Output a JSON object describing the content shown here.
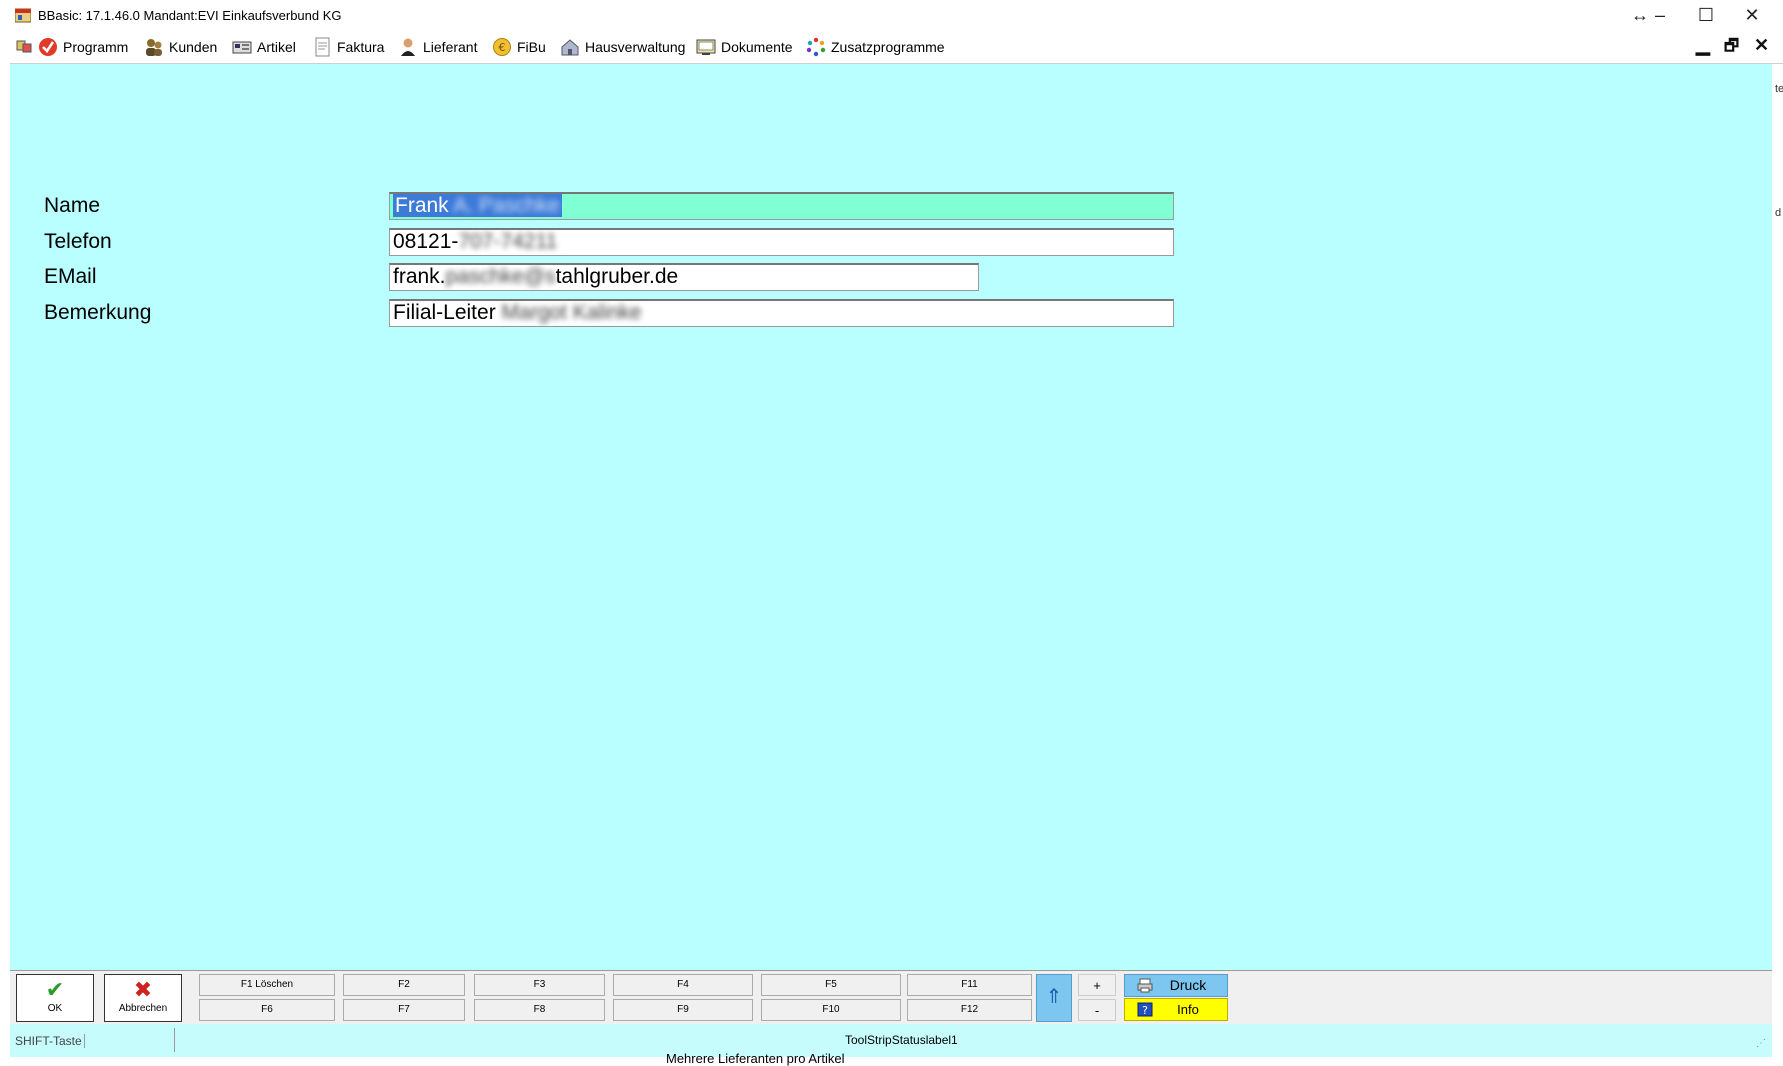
{
  "window": {
    "title": "BBasic: 17.1.46.0 Mandant:EVI Einkaufsverbund KG",
    "controls": {
      "resize_glyph": "↔",
      "minimize": "–",
      "maximize": "☐",
      "close": "✕"
    }
  },
  "menubar": {
    "items": [
      {
        "label": "Programm",
        "icon": "programm-icon"
      },
      {
        "label": "Kunden",
        "icon": "kunden-icon"
      },
      {
        "label": "Artikel",
        "icon": "artikel-icon"
      },
      {
        "label": "Faktura",
        "icon": "faktura-icon"
      },
      {
        "label": "Lieferant",
        "icon": "lieferant-icon"
      },
      {
        "label": "FiBu",
        "icon": "fibu-icon"
      },
      {
        "label": "Hausverwaltung",
        "icon": "hausverwaltung-icon"
      },
      {
        "label": "Dokumente",
        "icon": "dokumente-icon"
      },
      {
        "label": "Zusatzprogramme",
        "icon": "zusatzprogramme-icon"
      }
    ],
    "mdi_controls": {
      "minimize": "▁",
      "restore": "🗗",
      "close": "✕"
    }
  },
  "form": {
    "name": {
      "label": "Name",
      "value_clear": "Frank",
      "value_blurred": "A. Paschke"
    },
    "telefon": {
      "label": "Telefon",
      "value_clear": "08121-",
      "value_blurred": "707-74211"
    },
    "email": {
      "label": "EMail",
      "value_clear_prefix": "frank.",
      "value_blurred": "paschke@s",
      "value_clear_suffix": "tahlgruber.de"
    },
    "bemerkung": {
      "label": "Bemerkung",
      "value_clear": "Filial-Leiter",
      "value_blurred": "Margot Kalinke"
    }
  },
  "bottombar": {
    "ok_label": "OK",
    "cancel_label": "Abbrechen",
    "fkeys_top": [
      "F1 Löschen",
      "F2",
      "F3",
      "F4",
      "F5",
      "F11"
    ],
    "fkeys_bottom": [
      "F6",
      "F7",
      "F8",
      "F9",
      "F10",
      "F12"
    ],
    "plus": "+",
    "minus": "-",
    "druck_label": "Druck",
    "info_label": "Info"
  },
  "statusbar": {
    "shift_label": "SHIFT-Taste",
    "status_label": "ToolStripStatuslabel1"
  },
  "background_text": {
    "behind_window": "Mehrere Lieferanten pro Artikel",
    "edge_right_1": "te",
    "edge_right_2": "d"
  },
  "colors": {
    "client_bg": "#b9ffff",
    "active_field": "#80ffd5",
    "selection": "#3d7bd9",
    "druck_bg": "#7cc6f0",
    "info_bg": "#ffff00"
  }
}
